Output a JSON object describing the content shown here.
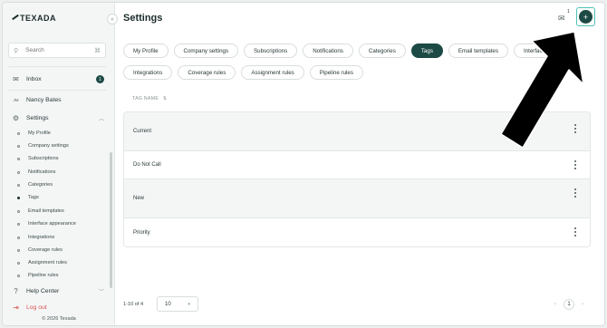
{
  "brand": "TEXADA",
  "sidebar": {
    "search_placeholder": "Search",
    "inbox_label": "Inbox",
    "inbox_count": "1",
    "user_initials": "JM",
    "user_name": "Nancy Bates",
    "settings_label": "Settings",
    "settings_items": [
      "My Profile",
      "Company settings",
      "Subscriptions",
      "Notifications",
      "Categories",
      "Tags",
      "Email templates",
      "Interface appearance",
      "Integrations",
      "Coverage rules",
      "Assignment rules",
      "Pipeline rules"
    ],
    "active_item": "Tags",
    "help_label": "Help Center",
    "logout_label": "Log out",
    "copyright": "© 2026 Texada"
  },
  "header": {
    "title": "Settings",
    "mail_count": "1",
    "add_label": "+"
  },
  "tabs_row1": [
    "My Profile",
    "Company settings",
    "Subscriptions",
    "Notifications",
    "Categories",
    "Tags",
    "Email templates",
    "Interface appea"
  ],
  "tabs_row2": [
    "Integrations",
    "Coverage rules",
    "Assignment rules",
    "Pipeline rules"
  ],
  "table": {
    "column": "TAG NAME",
    "sort_icon": "sort-icon",
    "rows": [
      "Current",
      "Do Not Call",
      "New",
      "Priority"
    ]
  },
  "pagination": {
    "range": "1-10 of 4",
    "per_page": "10",
    "page": "1"
  },
  "colors": {
    "accent": "#1d4a45",
    "highlight": "#4fc1b5",
    "danger": "#d9534f"
  }
}
